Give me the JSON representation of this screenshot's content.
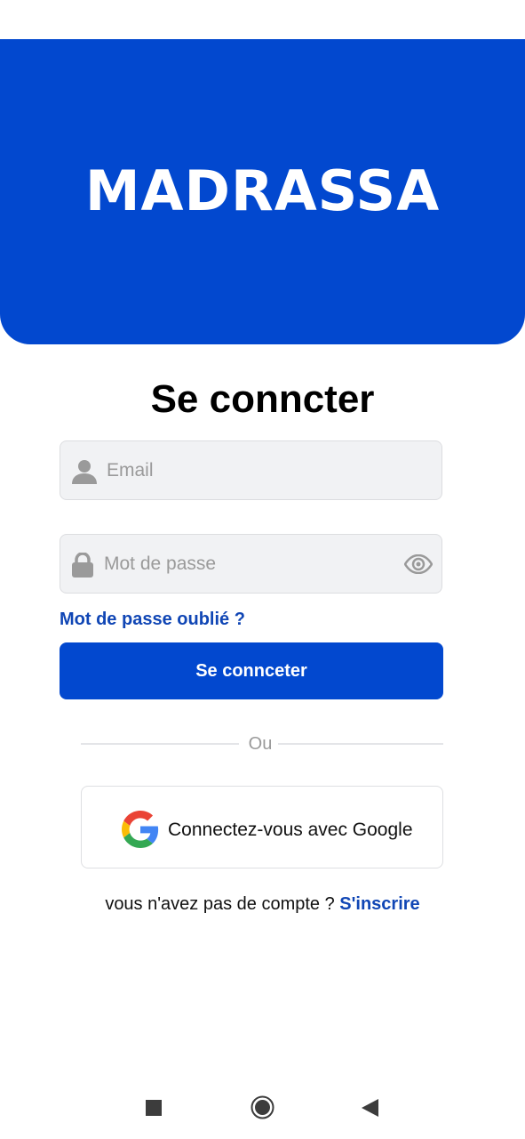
{
  "banner": {
    "logo_text": "MADRASSA",
    "color": "#0248cf"
  },
  "login": {
    "title": "Se conncter",
    "email_placeholder": "Email",
    "password_placeholder": "Mot de passe",
    "forgot_label": "Mot de passe oublié ?",
    "submit_label": "Se connceter",
    "divider_label": "Ou",
    "google_label": "Connectez-vous avec Google",
    "no_account_text": "vous n'avez pas de compte ?",
    "signup_label": "S'inscrire"
  },
  "icons": {
    "email": "user-icon",
    "password": "lock-icon",
    "toggle": "eye-icon",
    "google": "google-icon"
  },
  "colors": {
    "primary": "#0248cf",
    "link": "#1046b5",
    "field_bg": "#f1f2f4"
  },
  "system_nav": [
    "recent-apps-button",
    "home-button",
    "back-button"
  ]
}
